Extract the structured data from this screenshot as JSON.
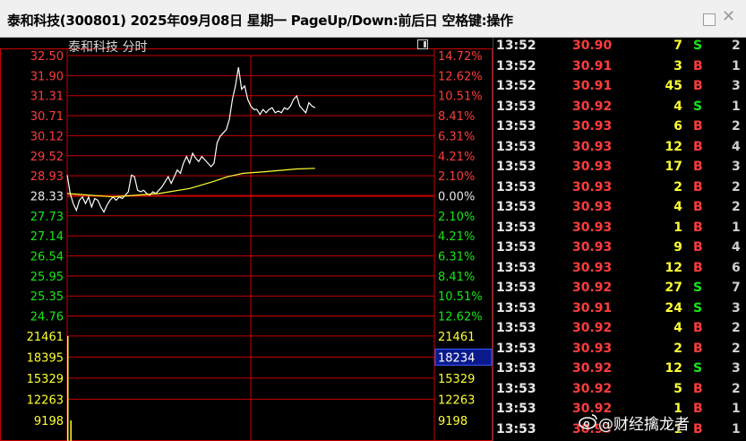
{
  "window": {
    "title": "泰和科技(300801) 2025年09月08日 星期一 PageUp/Down:前后日 空格键:操作"
  },
  "chart": {
    "stock_label": "泰和科技  分时",
    "price_labels": [
      "32.50",
      "31.90",
      "31.31",
      "30.71",
      "30.12",
      "29.52",
      "28.93",
      "28.33",
      "27.73",
      "27.14",
      "26.54",
      "25.95",
      "25.35",
      "24.76"
    ],
    "pct_labels": [
      "14.72%",
      "12.62%",
      "10.51%",
      "8.41%",
      "6.31%",
      "4.21%",
      "2.10%",
      "0.00%",
      "2.10%",
      "4.21%",
      "6.31%",
      "8.41%",
      "10.51%",
      "12.62%"
    ],
    "volume_labels_left": [
      "21461",
      "18395",
      "15329",
      "12263",
      "9198"
    ],
    "volume_labels_right": [
      "21461",
      "18234",
      "15329",
      "12263",
      "9198"
    ],
    "volume_highlight": "18234"
  },
  "chart_data": {
    "type": "line",
    "title": "泰和科技  分时",
    "ylim": [
      24.76,
      32.5
    ],
    "prev_close": 28.33,
    "series": [
      {
        "name": "price",
        "color": "#ffffff",
        "points": [
          [
            0,
            28.95
          ],
          [
            2,
            28.4
          ],
          [
            4,
            28.1
          ],
          [
            6,
            27.9
          ],
          [
            8,
            28.2
          ],
          [
            10,
            28.3
          ],
          [
            12,
            28.1
          ],
          [
            14,
            28.3
          ],
          [
            16,
            28.0
          ],
          [
            18,
            28.25
          ],
          [
            20,
            28.2
          ],
          [
            22,
            28.0
          ],
          [
            24,
            27.85
          ],
          [
            26,
            28.05
          ],
          [
            28,
            28.2
          ],
          [
            30,
            28.3
          ],
          [
            32,
            28.2
          ],
          [
            34,
            28.3
          ],
          [
            36,
            28.25
          ],
          [
            38,
            28.35
          ],
          [
            40,
            28.45
          ],
          [
            42,
            28.95
          ],
          [
            44,
            28.9
          ],
          [
            46,
            28.5
          ],
          [
            48,
            28.45
          ],
          [
            50,
            28.5
          ],
          [
            52,
            28.4
          ],
          [
            54,
            28.35
          ],
          [
            56,
            28.45
          ],
          [
            58,
            28.4
          ],
          [
            60,
            28.5
          ],
          [
            62,
            28.6
          ],
          [
            64,
            28.75
          ],
          [
            66,
            28.9
          ],
          [
            68,
            28.7
          ],
          [
            70,
            28.9
          ],
          [
            72,
            29.1
          ],
          [
            74,
            29.0
          ],
          [
            76,
            29.3
          ],
          [
            78,
            29.5
          ],
          [
            80,
            29.3
          ],
          [
            82,
            29.6
          ],
          [
            84,
            29.45
          ],
          [
            86,
            29.35
          ],
          [
            88,
            29.5
          ],
          [
            90,
            29.4
          ],
          [
            92,
            29.3
          ],
          [
            94,
            29.2
          ],
          [
            96,
            29.3
          ],
          [
            98,
            29.9
          ],
          [
            100,
            30.1
          ],
          [
            102,
            30.2
          ],
          [
            104,
            30.3
          ],
          [
            106,
            30.6
          ],
          [
            108,
            31.2
          ],
          [
            110,
            31.6
          ],
          [
            112,
            32.15
          ],
          [
            114,
            31.5
          ],
          [
            116,
            31.6
          ],
          [
            118,
            31.2
          ],
          [
            120,
            31.0
          ],
          [
            122,
            30.9
          ],
          [
            124,
            30.9
          ],
          [
            126,
            30.75
          ],
          [
            128,
            30.9
          ],
          [
            130,
            30.8
          ],
          [
            132,
            30.9
          ],
          [
            134,
            30.95
          ],
          [
            136,
            30.8
          ],
          [
            138,
            30.85
          ],
          [
            140,
            30.8
          ],
          [
            142,
            30.95
          ],
          [
            144,
            30.9
          ],
          [
            146,
            31.0
          ],
          [
            148,
            31.2
          ],
          [
            150,
            31.3
          ],
          [
            152,
            31.0
          ],
          [
            154,
            30.9
          ],
          [
            156,
            30.8
          ],
          [
            158,
            31.1
          ],
          [
            160,
            31.0
          ],
          [
            162,
            30.95
          ]
        ]
      },
      {
        "name": "average",
        "color": "#ffff33",
        "points": [
          [
            0,
            28.4
          ],
          [
            30,
            28.3
          ],
          [
            60,
            28.4
          ],
          [
            80,
            28.55
          ],
          [
            95,
            28.75
          ],
          [
            105,
            28.9
          ],
          [
            115,
            29.0
          ],
          [
            130,
            29.05
          ],
          [
            150,
            29.13
          ],
          [
            162,
            29.15
          ]
        ]
      }
    ],
    "volume_bars": [
      [
        0,
        21461
      ],
      [
        2,
        4200
      ]
    ]
  },
  "ticks": [
    {
      "time": "13:52",
      "price": "30.90",
      "vol": "7",
      "dir": "S",
      "count": "2"
    },
    {
      "time": "13:52",
      "price": "30.91",
      "vol": "3",
      "dir": "B",
      "count": "1"
    },
    {
      "time": "13:52",
      "price": "30.91",
      "vol": "45",
      "dir": "B",
      "count": "3"
    },
    {
      "time": "13:53",
      "price": "30.92",
      "vol": "4",
      "dir": "S",
      "count": "1"
    },
    {
      "time": "13:53",
      "price": "30.93",
      "vol": "6",
      "dir": "B",
      "count": "2"
    },
    {
      "time": "13:53",
      "price": "30.93",
      "vol": "12",
      "dir": "B",
      "count": "4"
    },
    {
      "time": "13:53",
      "price": "30.93",
      "vol": "17",
      "dir": "B",
      "count": "3"
    },
    {
      "time": "13:53",
      "price": "30.93",
      "vol": "2",
      "dir": "B",
      "count": "2"
    },
    {
      "time": "13:53",
      "price": "30.93",
      "vol": "4",
      "dir": "B",
      "count": "2"
    },
    {
      "time": "13:53",
      "price": "30.93",
      "vol": "1",
      "dir": "B",
      "count": "1"
    },
    {
      "time": "13:53",
      "price": "30.93",
      "vol": "9",
      "dir": "B",
      "count": "4"
    },
    {
      "time": "13:53",
      "price": "30.93",
      "vol": "12",
      "dir": "B",
      "count": "6"
    },
    {
      "time": "13:53",
      "price": "30.92",
      "vol": "27",
      "dir": "S",
      "count": "7"
    },
    {
      "time": "13:53",
      "price": "30.91",
      "vol": "24",
      "dir": "S",
      "count": "3"
    },
    {
      "time": "13:53",
      "price": "30.92",
      "vol": "4",
      "dir": "B",
      "count": "2"
    },
    {
      "time": "13:53",
      "price": "30.93",
      "vol": "2",
      "dir": "B",
      "count": "2"
    },
    {
      "time": "13:53",
      "price": "30.92",
      "vol": "12",
      "dir": "S",
      "count": "3"
    },
    {
      "time": "13:53",
      "price": "30.92",
      "vol": "5",
      "dir": "B",
      "count": "2"
    },
    {
      "time": "13:53",
      "price": "30.92",
      "vol": "1",
      "dir": "B",
      "count": "1"
    },
    {
      "time": "13:53",
      "price": "30.93",
      "vol": "1",
      "dir": "B",
      "count": "1"
    }
  ],
  "watermark": "@财经擒龙者",
  "colors": {
    "up": "#ff3c3c",
    "down": "#19e619",
    "grid": "#c80000",
    "volume": "#ffff33",
    "text": "#e8e8e8"
  }
}
